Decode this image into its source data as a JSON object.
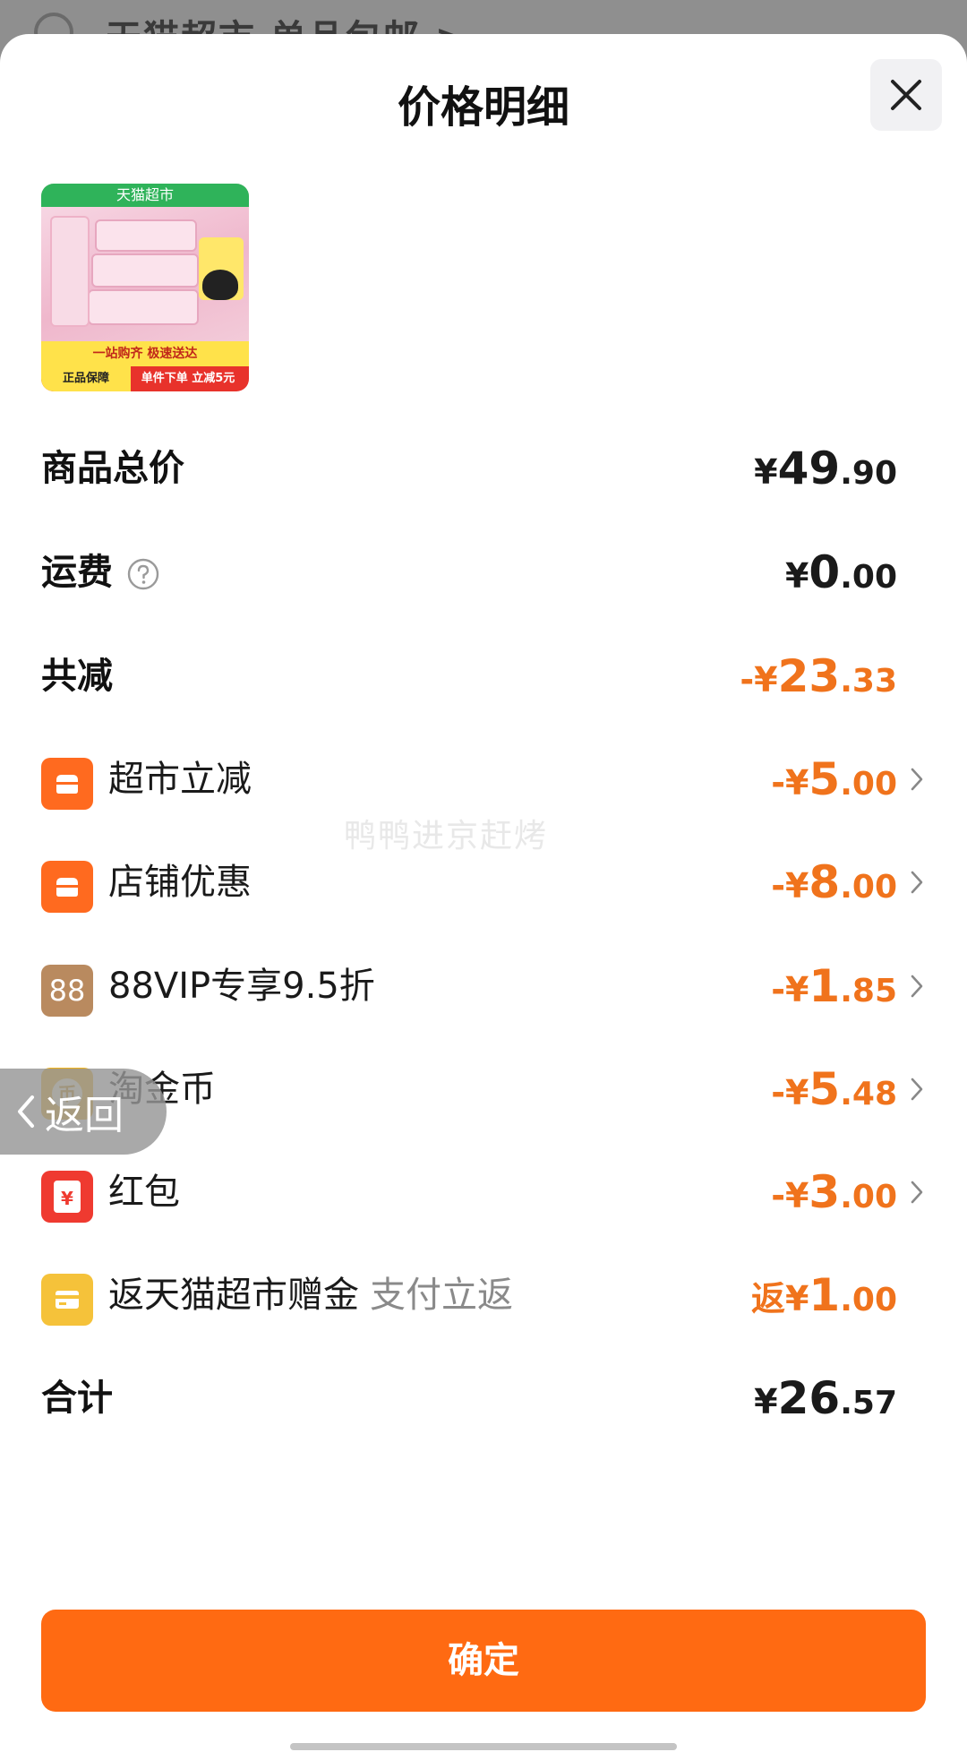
{
  "background_page": {
    "title": "天猫超市 单品包邮 >"
  },
  "sheet": {
    "title": "价格明细"
  },
  "product_image": {
    "top_banner": "天猫超市",
    "slogan": "一站购齐 极速送达",
    "guarantee": "正品保障",
    "promo": "单件下单 立减5元"
  },
  "rows": {
    "subtotal": {
      "label": "商品总价",
      "currency": "¥",
      "int": "49",
      "dec": ".90"
    },
    "shipping": {
      "label": "运费",
      "currency": "¥",
      "int": "0",
      "dec": ".00"
    },
    "total_discount": {
      "label": "共减",
      "currency": "-¥",
      "int": "23",
      "dec": ".33"
    },
    "supermarket_discount": {
      "label": "超市立减",
      "currency": "-¥",
      "int": "5",
      "dec": ".00"
    },
    "store_discount": {
      "label": "店铺优惠",
      "currency": "-¥",
      "int": "8",
      "dec": ".00"
    },
    "vip_discount": {
      "label": "88VIP专享9.5折",
      "icon_text": "88",
      "currency": "-¥",
      "int": "1",
      "dec": ".85"
    },
    "taojinbi": {
      "label": "淘金币",
      "icon_text": "币",
      "currency": "-¥",
      "int": "5",
      "dec": ".48"
    },
    "red_packet": {
      "label": "红包",
      "icon_text": "¥",
      "currency": "-¥",
      "int": "3",
      "dec": ".00"
    },
    "cashback": {
      "label": "返天猫超市赠金",
      "sublabel": "支付立返",
      "currency": "返¥",
      "int": "1",
      "dec": ".00"
    },
    "total": {
      "label": "合计",
      "currency": "¥",
      "int": "26",
      "dec": ".57"
    }
  },
  "watermark": "鸭鸭进京赶烤",
  "back_overlay": {
    "label": "返回"
  },
  "confirm_button": {
    "label": "确定"
  },
  "colors": {
    "accent": "#ff6a12",
    "discount": "#f0731c"
  }
}
